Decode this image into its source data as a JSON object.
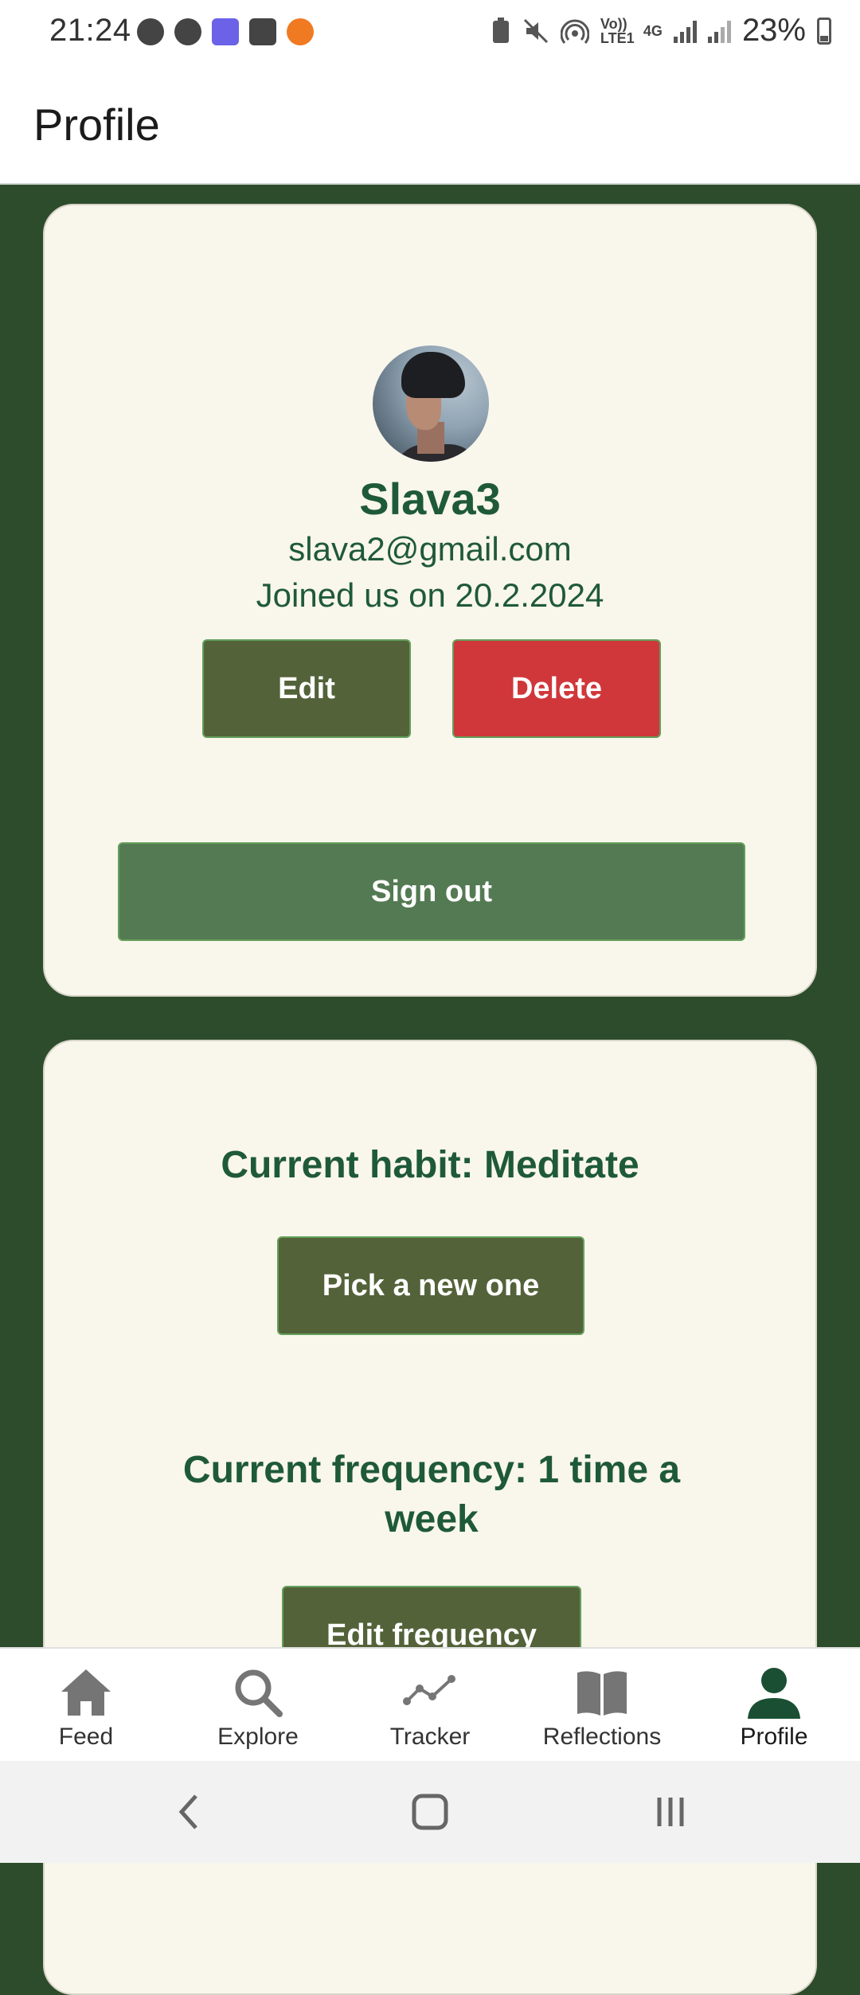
{
  "status_bar": {
    "time": "21:24",
    "volte_label": "Vo)) LTE1",
    "network_label": "4G",
    "battery": "23%"
  },
  "app_bar": {
    "title": "Profile"
  },
  "profile": {
    "name": "Slava3",
    "email": "slava2@gmail.com",
    "joined": "Joined us on 20.2.2024",
    "edit_label": "Edit",
    "delete_label": "Delete",
    "signout_label": "Sign out"
  },
  "habit": {
    "current_habit": "Current habit: Meditate",
    "pick_label": "Pick a new one",
    "current_frequency": "Current frequency: 1 time a week",
    "edit_frequency_label": "Edit frequency"
  },
  "bottom_nav": {
    "items": [
      {
        "label": "Feed",
        "icon": "home-icon"
      },
      {
        "label": "Explore",
        "icon": "search-icon"
      },
      {
        "label": "Tracker",
        "icon": "chart-line-icon"
      },
      {
        "label": "Reflections",
        "icon": "book-icon"
      },
      {
        "label": "Profile",
        "icon": "person-icon"
      }
    ],
    "active": "Profile"
  },
  "colors": {
    "background": "#2d4c2b",
    "card": "#f9f6ec",
    "text_green": "#1f5a38",
    "olive_button": "#536239",
    "red_button": "#d0373a",
    "signout_button": "#547a53",
    "nav_active": "#1a4f33"
  }
}
